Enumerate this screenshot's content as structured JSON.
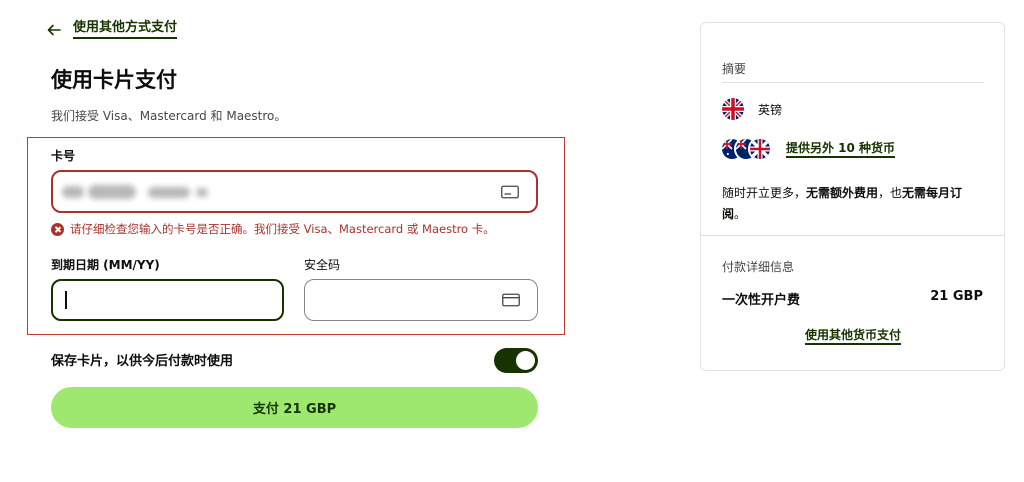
{
  "back": {
    "label": "使用其他方式支付"
  },
  "page": {
    "title": "使用卡片支付",
    "subtitle": "我们接受 Visa、Mastercard 和 Maestro。"
  },
  "card_number": {
    "label": "卡号",
    "value": "",
    "error": "请仔细检查您输入的卡号是否正确。我们接受 Visa、Mastercard 或 Maestro 卡。"
  },
  "expiry": {
    "label": "到期日期 (MM/YY)",
    "value": ""
  },
  "cvc": {
    "label": "安全码",
    "value": ""
  },
  "save_card": {
    "label": "保存卡片，以供今后付款时使用",
    "enabled": true
  },
  "pay_button": {
    "label": "支付 21 GBP"
  },
  "summary": {
    "title": "摘要",
    "currency": {
      "name": "英镑",
      "flag": "uk-flag-icon"
    },
    "more_currencies_link": "提供另外 10 种货币",
    "note_part1": "随时开立更多，",
    "note_bold1": "无需额外费用",
    "note_part2": "，也",
    "note_bold2": "无需每月订阅",
    "note_part3": "。",
    "payment_details_title": "付款详细信息",
    "fee_label": "一次性开户费",
    "fee_value": "21 GBP",
    "other_currency_link": "使用其他货币支付"
  },
  "colors": {
    "brand_dark_green": "#163300",
    "button_green": "#9fe870",
    "error_red": "#a8322d"
  }
}
